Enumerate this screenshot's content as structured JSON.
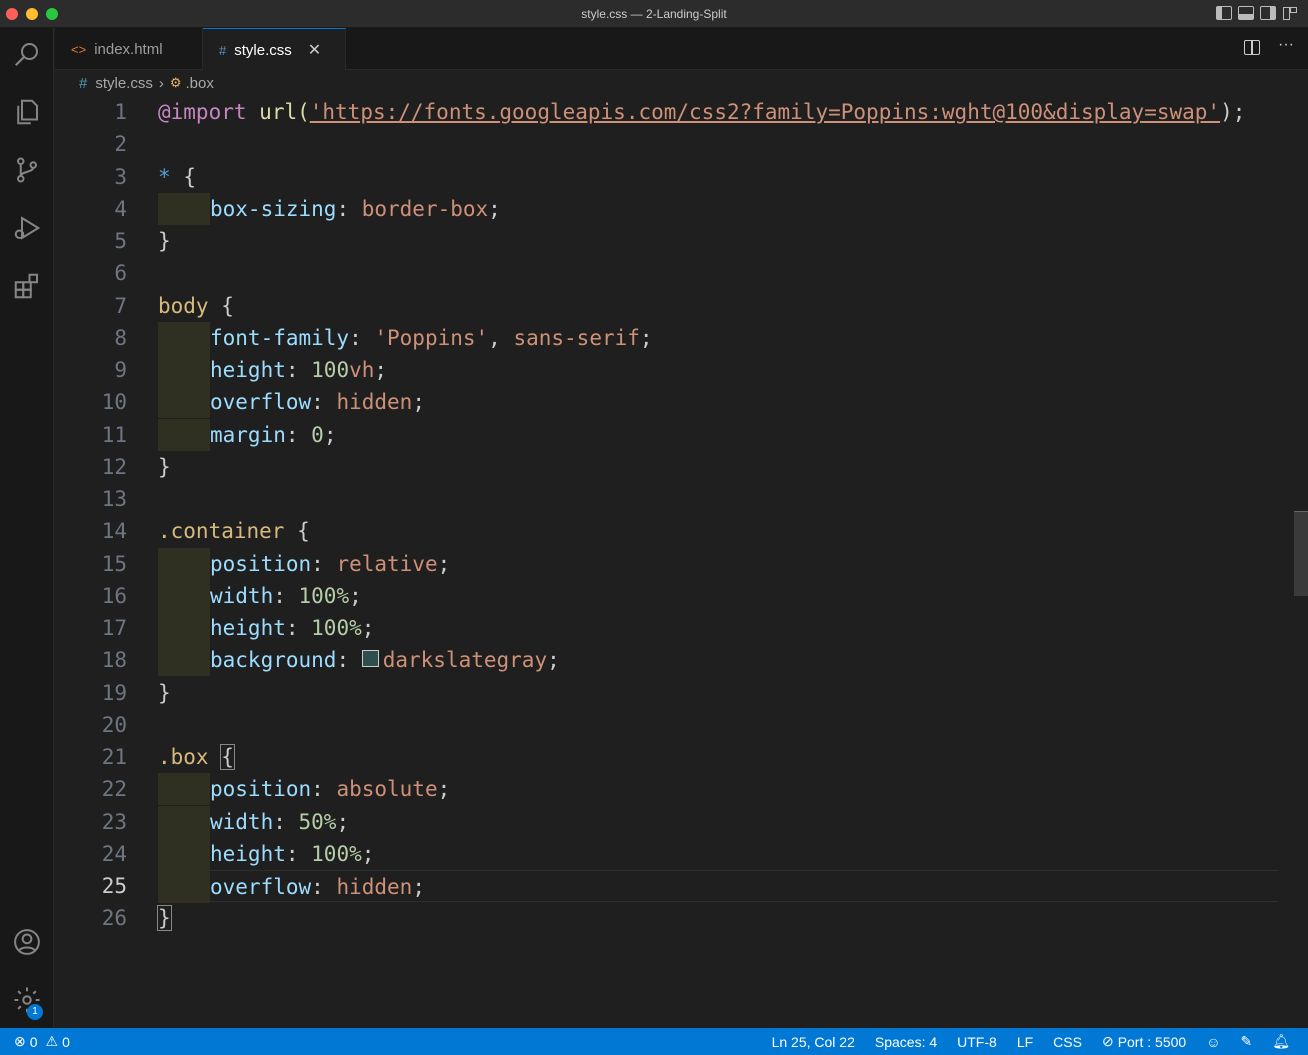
{
  "window": {
    "title": "style.css — 2-Landing-Split"
  },
  "tabs": [
    {
      "label": "index.html",
      "icon": "<>",
      "active": false
    },
    {
      "label": "style.css",
      "icon": "#",
      "active": true
    }
  ],
  "breadcrumb": {
    "file": "style.css",
    "symbol": ".box"
  },
  "editor": {
    "line_numbers": [
      "1",
      "2",
      "3",
      "4",
      "5",
      "6",
      "7",
      "8",
      "9",
      "10",
      "11",
      "12",
      "13",
      "14",
      "15",
      "16",
      "17",
      "18",
      "19",
      "20",
      "21",
      "22",
      "23",
      "24",
      "25",
      "26"
    ],
    "current_line": 25,
    "lines": {
      "l1_at": "@import",
      "l1_fn": "url(",
      "l1_str": "'https://fonts.googleapis.com/css2?family=Poppins:wght@100&display=swap'",
      "l1_end": ");",
      "l3_star": "*",
      "l3_brace": "{",
      "l4_prop": "box-sizing",
      "l4_val": "border-box",
      "close_brace": "}",
      "l7_sel": "body",
      "l8_prop": "font-family",
      "l8_str": "'Poppins'",
      "l8_val": "sans-serif",
      "l9_prop": "height",
      "l9_num": "100",
      "l9_unit": "vh",
      "l10_prop": "overflow",
      "l10_val": "hidden",
      "l11_prop": "margin",
      "l11_num": "0",
      "l14_sel": ".container",
      "l15_prop": "position",
      "l15_val": "relative",
      "l16_prop": "width",
      "l16_num": "100%",
      "l17_prop": "height",
      "l17_num": "100%",
      "l18_prop": "background",
      "l18_val": "darkslategray",
      "l21_sel": ".box",
      "l22_prop": "position",
      "l22_val": "absolute",
      "l23_prop": "width",
      "l23_num": "50%",
      "l24_prop": "height",
      "l24_num": "100%",
      "l25_prop": "overflow",
      "l25_val": "hidden"
    },
    "swatch_color": "#2f4f4f"
  },
  "activity_bar": {
    "badge_count": "1",
    "icons": [
      "search-icon",
      "explorer-icon",
      "source-control-icon",
      "run-debug-icon",
      "extensions-icon",
      "account-icon",
      "gear-icon"
    ]
  },
  "status": {
    "errors": "0",
    "warnings": "0",
    "position": "Ln 25, Col 22",
    "spaces": "Spaces: 4",
    "encoding": "UTF-8",
    "eol": "LF",
    "language": "CSS",
    "port": "Port : 5500"
  },
  "colors": {
    "accent": "#0078d4",
    "background": "#1f1f1f"
  }
}
